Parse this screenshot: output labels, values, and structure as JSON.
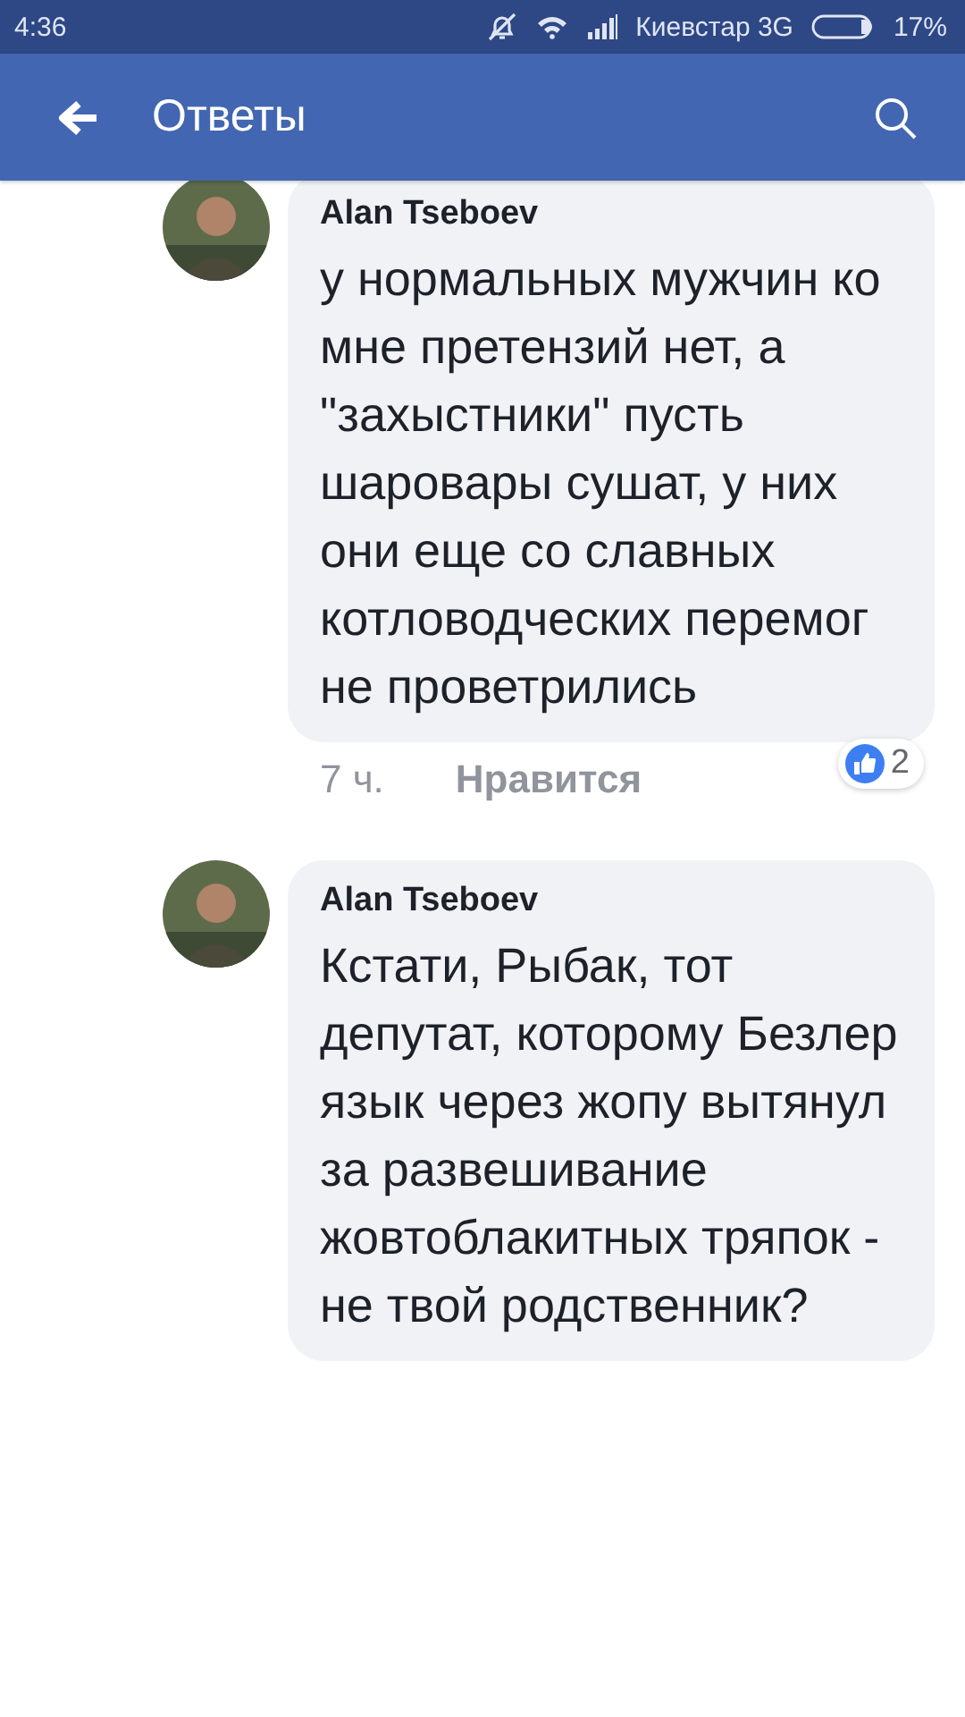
{
  "status_bar": {
    "time": "4:36",
    "carrier": "Киевстар 3G",
    "battery": "17%"
  },
  "header": {
    "title": "Ответы"
  },
  "comments": [
    {
      "author": "Alan Tseboev",
      "text": "у нормальных мужчин ко мне претензий нет, а \"захыстники\" пусть шаровары сушат, у них они еще со славных котловодческих перемог не проветрились",
      "time": "7 ч.",
      "like_label": "Нравится",
      "reactions": "2"
    },
    {
      "author": "Alan Tseboev",
      "text": "Кстати, Рыбак, тот депутат, которому Безлер язык через жопу вытянул за развешивание жовтоблакитных тряпок -  не твой родственник?"
    }
  ]
}
